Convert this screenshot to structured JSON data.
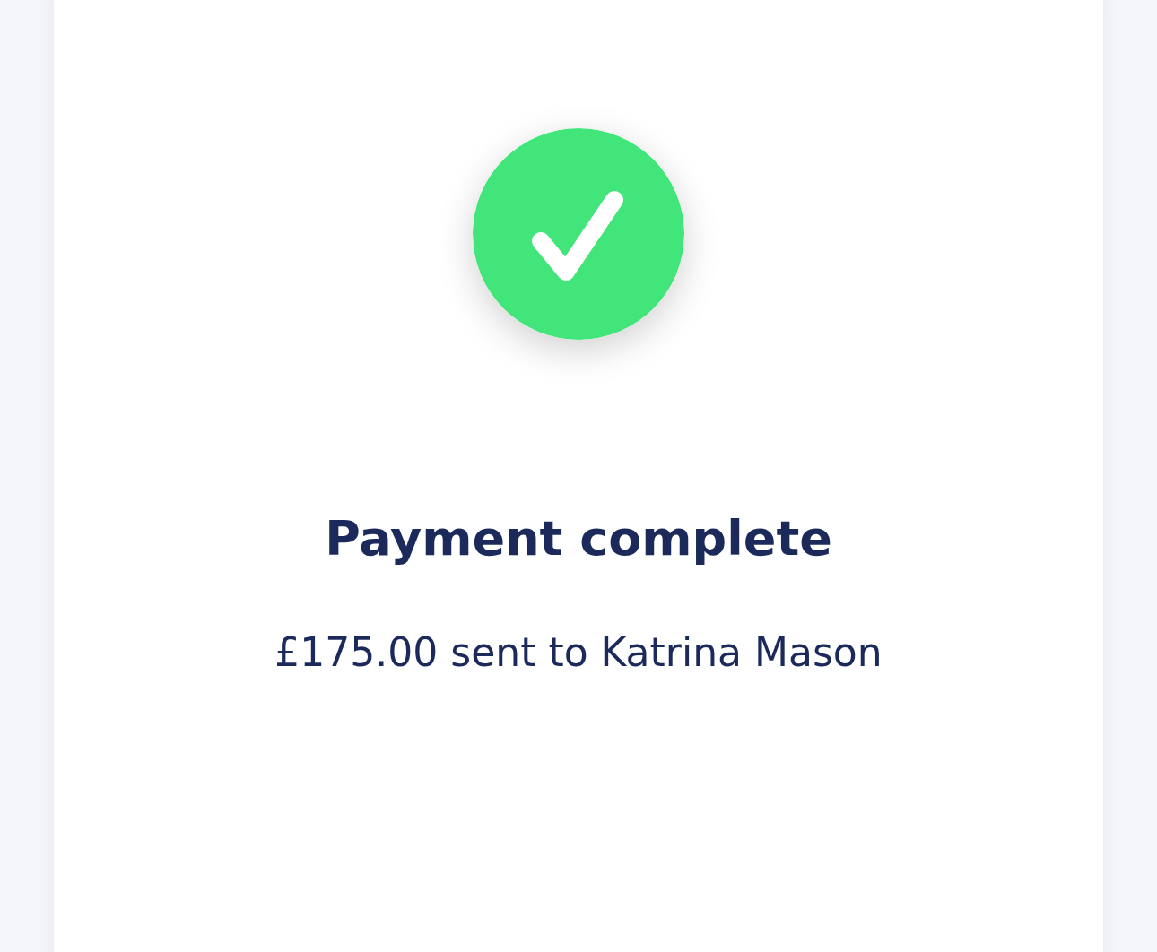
{
  "card": {
    "title": "Payment complete",
    "message": "£175.00 sent to Katrina Mason"
  }
}
